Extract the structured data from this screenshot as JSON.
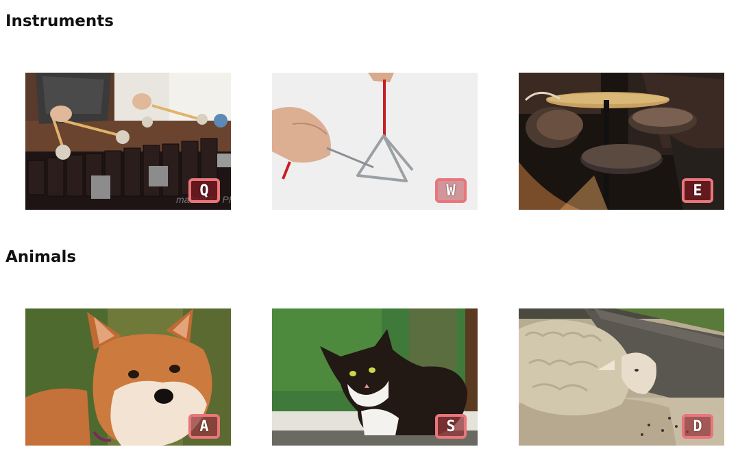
{
  "sections": [
    {
      "title": "Instruments",
      "items": [
        {
          "key": "Q",
          "icon": "xylophone-image"
        },
        {
          "key": "W",
          "icon": "triangle-image"
        },
        {
          "key": "E",
          "icon": "drum-kit-image"
        }
      ]
    },
    {
      "title": "Animals",
      "items": [
        {
          "key": "A",
          "icon": "dog-image"
        },
        {
          "key": "S",
          "icon": "cat-image"
        },
        {
          "key": "D",
          "icon": "sheep-image"
        }
      ]
    }
  ],
  "colors": {
    "badge_border": "#e8767a",
    "badge_text": "#ffffff"
  },
  "image_texts": {
    "xylophone_brand": "malletKAT PRO"
  }
}
